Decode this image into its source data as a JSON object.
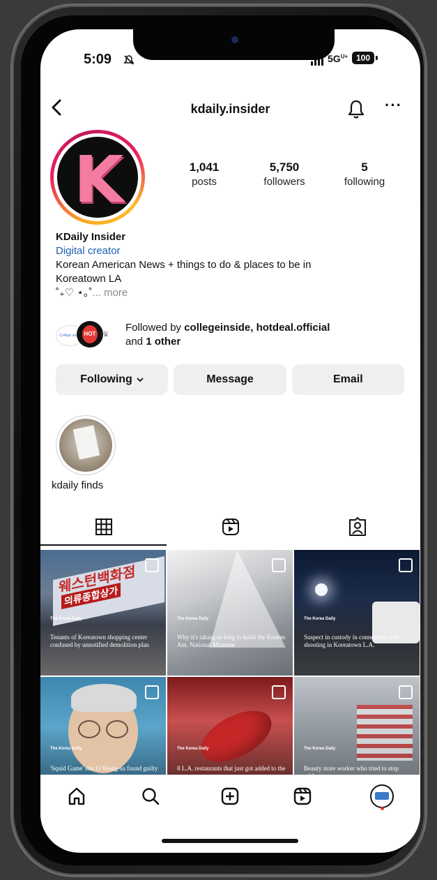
{
  "status": {
    "time": "5:09",
    "network": "5G",
    "network_sup": "U+",
    "battery": "100"
  },
  "header": {
    "username": "kdaily.insider",
    "more_label": "···"
  },
  "profile": {
    "avatar_letter": "K",
    "stats": [
      {
        "value": "1,041",
        "label": "posts"
      },
      {
        "value": "5,750",
        "label": "followers"
      },
      {
        "value": "5",
        "label": "following"
      }
    ],
    "name": "KDaily Insider",
    "category": "Digital creator",
    "bio_line1": "Korean American News + things to do & places to be in",
    "bio_line2": "Koreatown LA",
    "bio_line3": "˚₊♡ ⋆｡˚",
    "more_text": "... more"
  },
  "followed_by": {
    "prefix": "Followed by ",
    "names": "collegeinside, hotdeal.official",
    "suffix_pre": "and ",
    "suffix_bold": "1 other",
    "fav1_text": "College inside",
    "fav2_text": "HOT DEAL",
    "fav3_text": "핫딜"
  },
  "actions": {
    "following": "Following",
    "message": "Message",
    "email": "Email"
  },
  "highlights": [
    {
      "label": "kdaily finds"
    }
  ],
  "tabs": [
    "grid-icon",
    "reels-icon",
    "tagged-icon"
  ],
  "posts": [
    {
      "mark": "The Korea Daily",
      "caption": "Tenants of Koreatown shopping center confused by unnotified demolition plan",
      "sign_main": "웨스턴백화점",
      "sign_sub": "의류종합상가"
    },
    {
      "mark": "The Korea Daily",
      "caption": "Why it's taking so long to build the Korean Am. National Museum"
    },
    {
      "mark": "The Korea Daily",
      "caption": "Suspect in custody in connection with shooting in Koreatown L.A."
    },
    {
      "mark": "The Korea Daily",
      "caption": "'Squid Game' star O Yeong-su found guilty"
    },
    {
      "mark": "The Korea Daily",
      "caption": "8 L.A. restaurants that just got added to the"
    },
    {
      "mark": "The Korea Daily",
      "caption": "Beauty store worker who tried to stop robbers"
    }
  ],
  "tabbar": [
    "home-icon",
    "search-icon",
    "create-icon",
    "reels-icon",
    "profile-icon"
  ],
  "colors": {
    "category_link": "#1a5fb4",
    "button_bg": "#efefef",
    "notification_dot": "#e53935"
  }
}
